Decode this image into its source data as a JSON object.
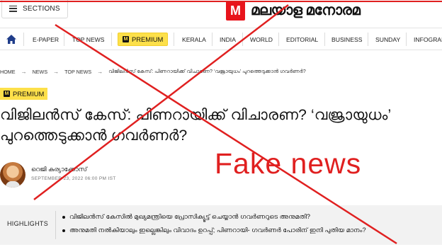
{
  "header": {
    "sections_label": "SECTIONS",
    "logo_badge": "M",
    "logo_text": "മലയാള മനോരമ"
  },
  "nav": {
    "items": [
      "E-PAPER",
      "TOP NEWS",
      "PREMIUM",
      "KERALA",
      "INDIA",
      "WORLD",
      "EDITORIAL",
      "BUSINESS",
      "SUNDAY",
      "INFOGRAP"
    ],
    "premium_badge": "M"
  },
  "breadcrumb": {
    "items": [
      "HOME",
      "NEWS",
      "TOP NEWS",
      "വിജിലൻസ് കേസ്: പിണറായിക്ക് വിചാരണ? ‘വജ്രായുധം’ പുറത്തെടുക്കാൻ ഗവർണർ?"
    ],
    "separator": "→"
  },
  "article": {
    "premium_tag": "PREMIUM",
    "premium_badge": "M",
    "headline_line1": "വിജിലൻസ് കേസ്: പിണറായിക്ക് വിചാരണ? ‘വജ്രായുധം’",
    "headline_line2": "പുറത്തെടുക്കാൻ ഗവർണർ?",
    "author_name": "റെജി കുര്യാക്കോസ്",
    "published": "SEPTEMBER 23, 2022 06:00 PM IST"
  },
  "highlights": {
    "label": "HIGHLIGHTS",
    "items": [
      "വിജിലൻസ് കേസിൽ മുഖ്യമന്ത്രിയെ പ്രോസിക്യൂട്ട് ചെയ്യാൻ ഗവർണറുടെ അനുമതി?",
      "അനുമതി നൽകിയാലും ഇല്ലെങ്കിലും വിവാദം ഉറപ്പ്; പിണറായി- ഗവർണർ പോരിന് ഇനി പുതിയ മാനം?"
    ]
  },
  "overlay": {
    "stamp_text": "Fake news",
    "stamp_color": "#e02020"
  },
  "colors": {
    "brand_red": "#e8141c",
    "premium_yellow": "#fde04a",
    "highlight_bg": "#f2f2f2"
  }
}
